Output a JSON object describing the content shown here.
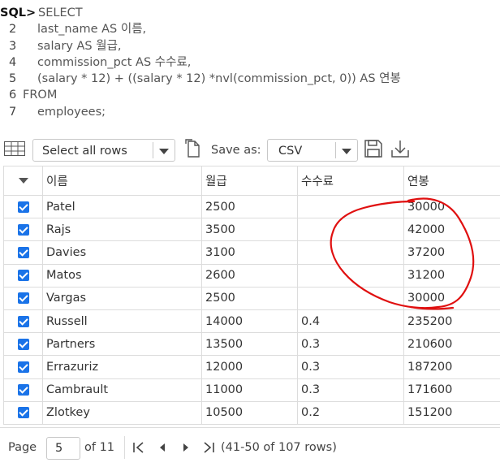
{
  "sql": {
    "prompt": "SQL>",
    "lines": [
      {
        "num": "",
        "code": "SELECT"
      },
      {
        "num": "2",
        "code": "last_name AS 이름,"
      },
      {
        "num": "3",
        "code": "salary AS 월급,"
      },
      {
        "num": "4",
        "code": "commission_pct AS 수수료,"
      },
      {
        "num": "5",
        "code": "(salary * 12) + ((salary * 12) *nvl(commission_pct, 0)) AS 연봉"
      },
      {
        "num": "6",
        "code": "FROM"
      },
      {
        "num": "7",
        "code": "employees;"
      }
    ]
  },
  "toolbar": {
    "grid_icon": "table-grid-icon",
    "select_value": "Select all rows",
    "doc_icon": "document-icon",
    "save_as_label": "Save as:",
    "format_value": "CSV",
    "save_icon": "floppy-disk-icon",
    "download_icon": "download-icon"
  },
  "table": {
    "columns": [
      "이름",
      "월급",
      "수수료",
      "연봉"
    ],
    "rows": [
      [
        "Patel",
        "2500",
        "",
        "30000"
      ],
      [
        "Rajs",
        "3500",
        "",
        "42000"
      ],
      [
        "Davies",
        "3100",
        "",
        "37200"
      ],
      [
        "Matos",
        "2600",
        "",
        "31200"
      ],
      [
        "Vargas",
        "2500",
        "",
        "30000"
      ],
      [
        "Russell",
        "14000",
        "0.4",
        "235200"
      ],
      [
        "Partners",
        "13500",
        "0.3",
        "210600"
      ],
      [
        "Errazuriz",
        "12000",
        "0.3",
        "187200"
      ],
      [
        "Cambrault",
        "11000",
        "0.3",
        "171600"
      ],
      [
        "Zlotkey",
        "10500",
        "0.2",
        "151200"
      ]
    ]
  },
  "pager": {
    "page_label": "Page",
    "page_value": "5",
    "of_label": "of 11",
    "info": "(41-50 of 107 rows)"
  },
  "colors": {
    "checkbox": "#1a73e8",
    "annotation": "#e01010"
  }
}
